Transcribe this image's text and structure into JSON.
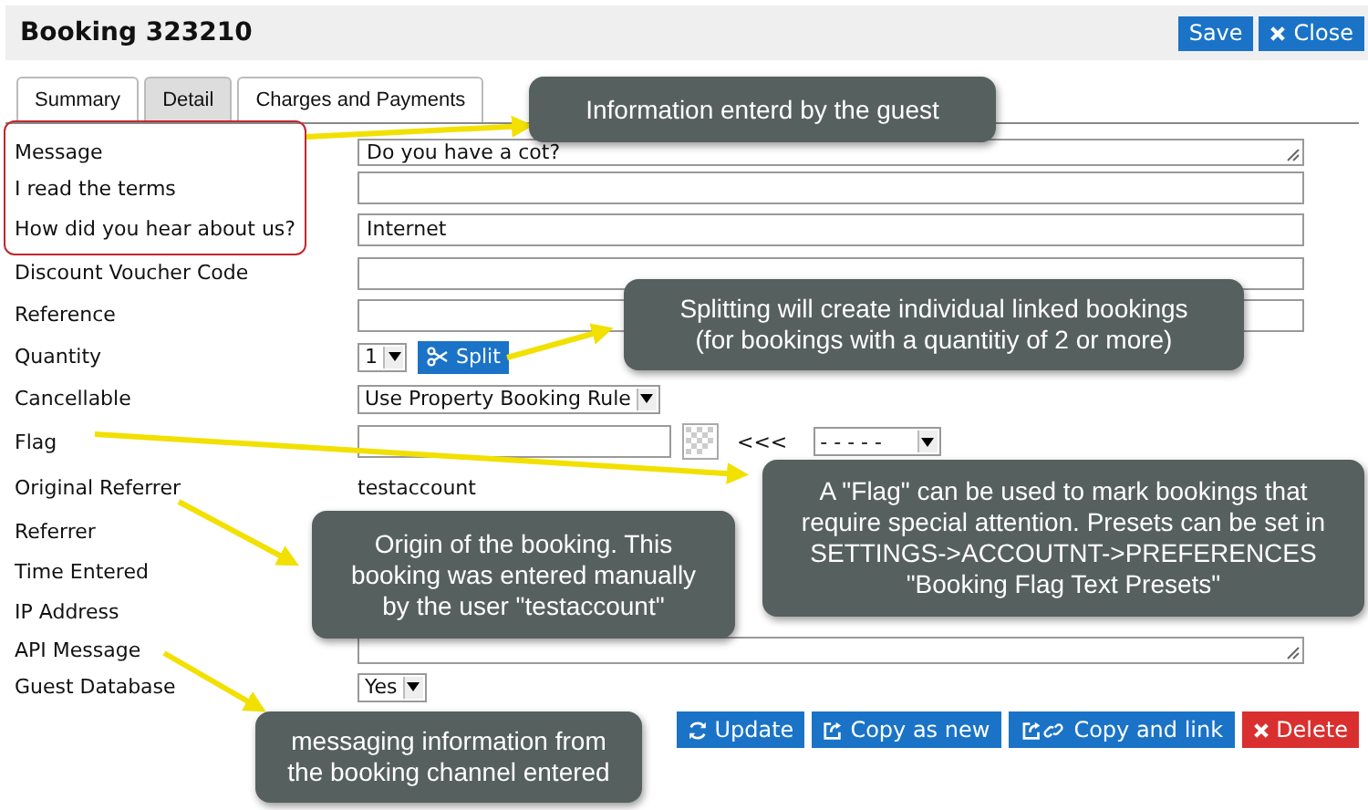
{
  "window": {
    "title": "Booking 323210"
  },
  "header_buttons": [
    {
      "label": "Save",
      "kind": "save"
    },
    {
      "label": "Close",
      "kind": "close"
    }
  ],
  "tabs": [
    {
      "label": "Summary",
      "selected": false
    },
    {
      "label": "Detail",
      "selected": true
    },
    {
      "label": "Charges and Payments",
      "selected": false
    }
  ],
  "fields": [
    {
      "label": "Message",
      "kind": "textarea",
      "value": "Do you have a cot?"
    },
    {
      "label": "I read the terms",
      "kind": "text"
    },
    {
      "label": "How did you hear about us?",
      "kind": "text",
      "value": "Internet"
    },
    {
      "label": "Discount Voucher Code",
      "kind": "text"
    },
    {
      "label": "Reference",
      "kind": "text"
    },
    {
      "label": "Quantity",
      "kind": "split",
      "value": "1",
      "button": "Split"
    },
    {
      "label": "Cancellable",
      "kind": "select",
      "value": "Use Property Booking Rule"
    },
    {
      "label": "Flag",
      "kind": "flag",
      "marker": "<<<",
      "value": "- - - - -"
    },
    {
      "label": "Original Referrer",
      "kind": "static",
      "value": "testaccount"
    },
    {
      "label": "Referrer",
      "kind": "blank"
    },
    {
      "label": "Time Entered",
      "kind": "blank"
    },
    {
      "label": "IP Address",
      "kind": "blank"
    },
    {
      "label": "API Message",
      "kind": "textarea"
    },
    {
      "label": "Guest Database",
      "kind": "select",
      "value": "Yes"
    }
  ],
  "actions": [
    {
      "label": "Update",
      "kind": "update"
    },
    {
      "label": "Copy as new",
      "kind": "copy"
    },
    {
      "label": "Copy and link",
      "kind": "link"
    },
    {
      "label": "Delete",
      "kind": "delete"
    }
  ],
  "callouts": [
    {
      "lines": [
        "Information enterd by the guest"
      ]
    },
    {
      "lines": [
        "Splitting will create individual linked bookings",
        "(for bookings with a quantitiy of 2 or more)"
      ]
    },
    {
      "lines": [
        "A \"Flag\" can be used to mark bookings that",
        "require special attention. Presets can be set in",
        "SETTINGS->ACCOUTNT->PREFERENCES",
        "\"Booking Flag Text Presets\""
      ]
    },
    {
      "lines": [
        "Origin of the booking. This",
        "booking was  entered manually",
        "by the user \"testaccount\""
      ]
    },
    {
      "lines": [
        "messaging information from",
        "the booking channel entered"
      ]
    }
  ]
}
